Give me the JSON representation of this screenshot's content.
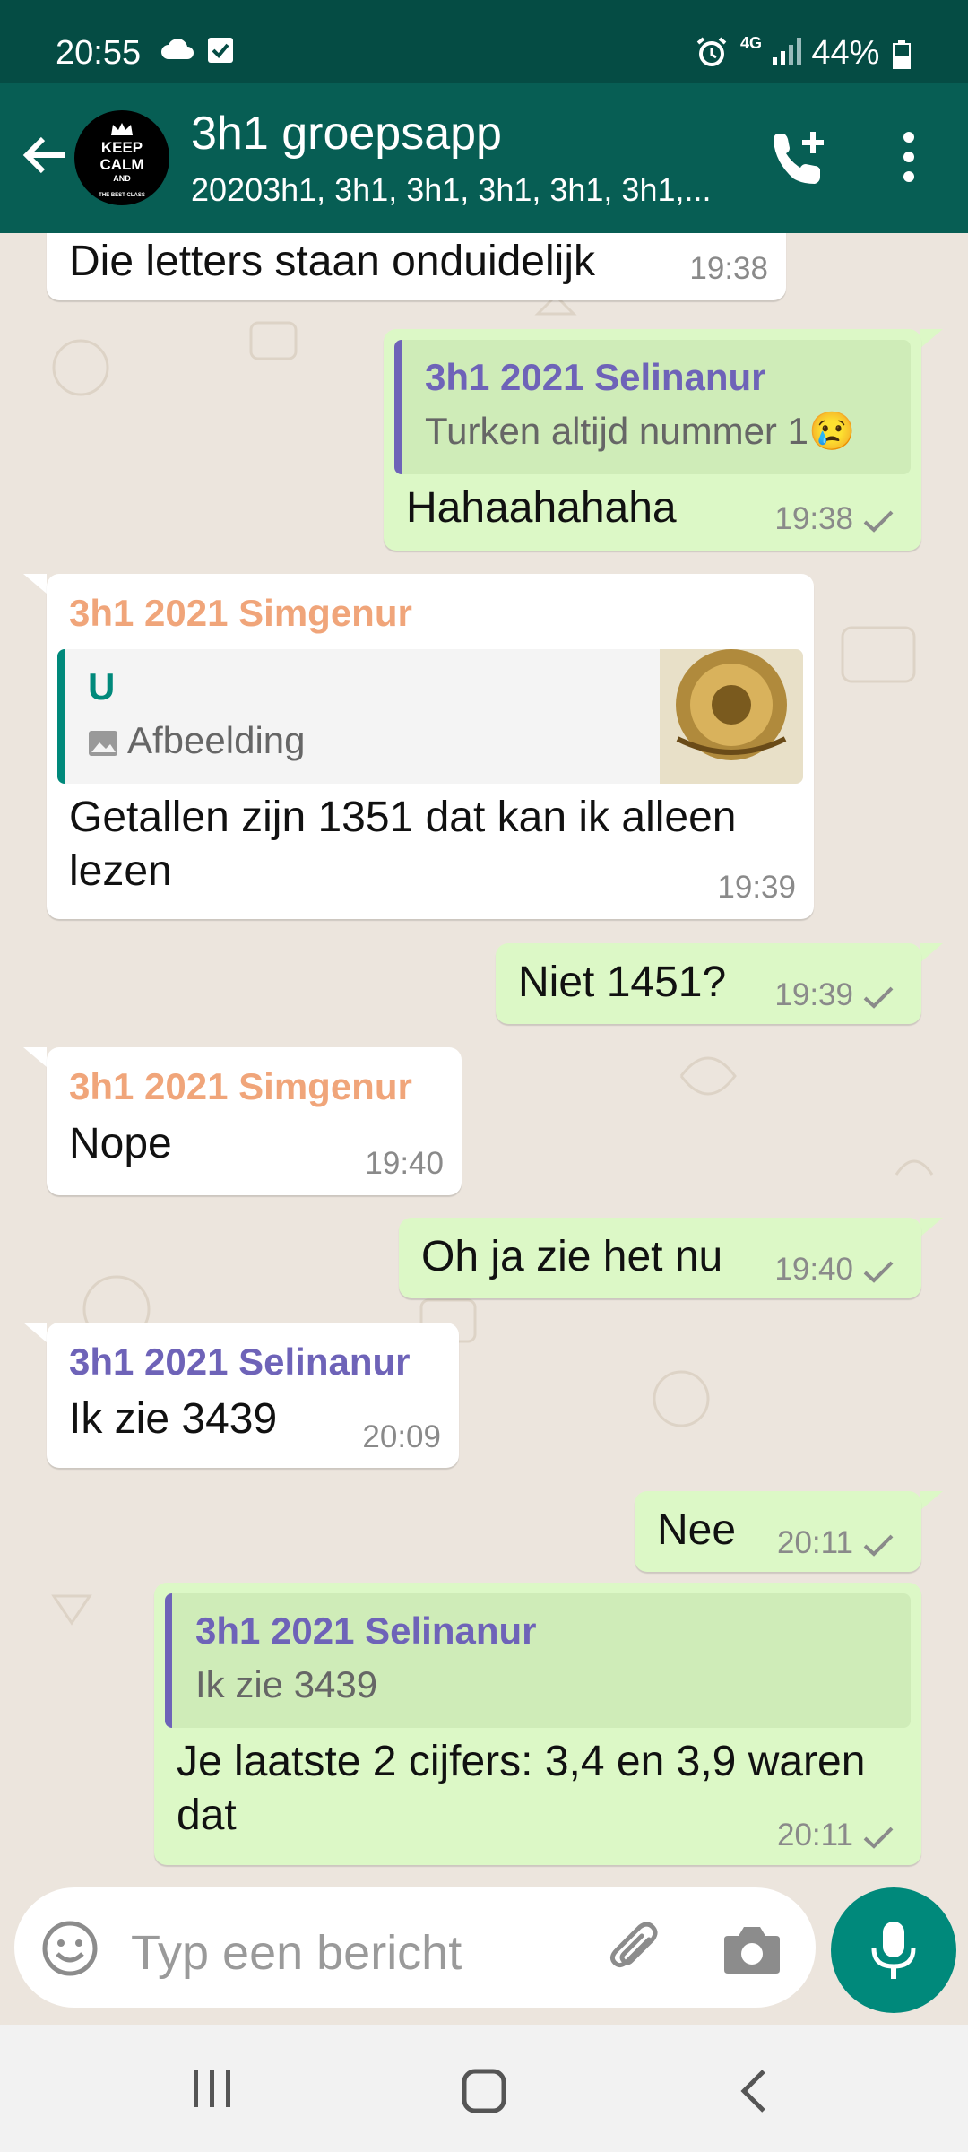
{
  "status": {
    "time": "20:55",
    "network": "4G",
    "battery": "44%"
  },
  "header": {
    "title": "3h1 groepsapp",
    "subtitle": "20203h1, 3h1, 3h1, 3h1, 3h1, 3h1,...",
    "avatar": {
      "line1": "KEEP",
      "line2": "CALM",
      "line3": "AND",
      "line4": "THE BEST CLASS"
    }
  },
  "messages": [
    {
      "dir": "in",
      "text": "Die letters staan onduidelijk",
      "time": "19:38"
    },
    {
      "dir": "out",
      "quote_author": "3h1 2021 Selinanur",
      "quote_text": "Turken altijd nummer 1",
      "quote_emoji": "😢",
      "text": "Hahaahahaha",
      "time": "19:38"
    },
    {
      "dir": "in",
      "sender": "3h1 2021 Simgenur",
      "quote_author": "U",
      "quote_text": "Afbeelding",
      "text": "Getallen zijn 1351 dat kan ik alleen lezen",
      "time": "19:39"
    },
    {
      "dir": "out",
      "text": "Niet 1451?",
      "time": "19:39"
    },
    {
      "dir": "in",
      "sender": "3h1 2021 Simgenur",
      "text": "Nope",
      "time": "19:40"
    },
    {
      "dir": "out",
      "text": "Oh ja zie het nu",
      "time": "19:40"
    },
    {
      "dir": "in",
      "sender": "3h1 2021 Selinanur",
      "text": "Ik zie 3439",
      "time": "20:09"
    },
    {
      "dir": "out",
      "text": "Nee",
      "time": "20:11"
    },
    {
      "dir": "out",
      "quote_author": "3h1 2021 Selinanur",
      "quote_text": "Ik zie 3439",
      "text": "Je laatste 2 cijfers: 3,4 en 3,9 waren dat",
      "time": "20:11"
    }
  ],
  "colors": {
    "simgenur": "#f0a57a",
    "selinanur": "#6e63b8",
    "header": "#075e54",
    "outgoing": "#dcf8c6",
    "accent": "#00897b"
  },
  "input": {
    "placeholder": "Typ een bericht"
  },
  "icons": [
    "back-arrow-icon",
    "add-call-icon",
    "more-vert-icon",
    "emoji-icon",
    "attach-icon",
    "camera-icon",
    "mic-icon",
    "image-icon",
    "check-icon"
  ]
}
